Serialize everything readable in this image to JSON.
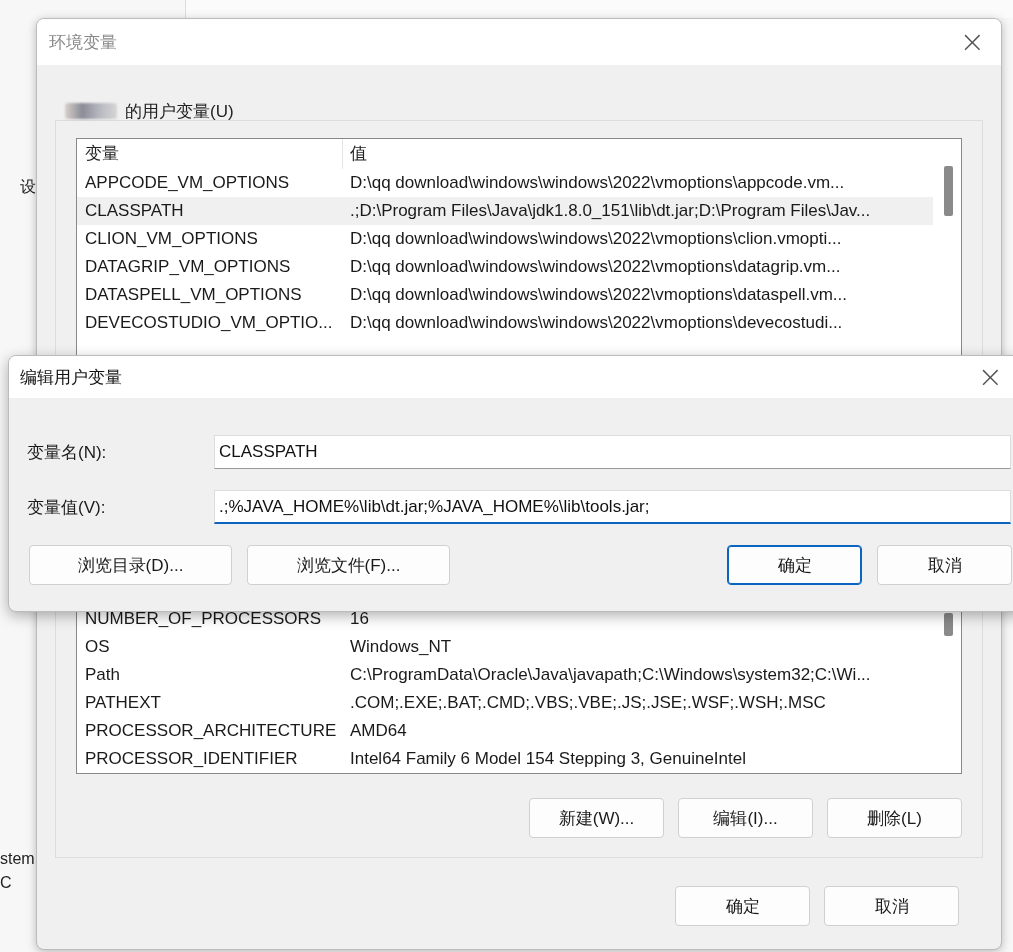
{
  "background_app": {
    "left_top": [
      "设"
    ],
    "left_bottom": [
      "stem",
      "C"
    ]
  },
  "env_dialog": {
    "title": "环境变量",
    "close": "×",
    "group_label": "的用户变量(U)",
    "table": {
      "columns": [
        "变量",
        "值"
      ],
      "rows_top": [
        {
          "name": "APPCODE_VM_OPTIONS",
          "value": "D:\\qq download\\windows\\windows\\2022\\vmoptions\\appcode.vm...",
          "selected": false
        },
        {
          "name": "CLASSPATH",
          "value": ".;D:\\Program Files\\Java\\jdk1.8.0_151\\lib\\dt.jar;D:\\Program Files\\Jav...",
          "selected": true
        },
        {
          "name": "CLION_VM_OPTIONS",
          "value": "D:\\qq download\\windows\\windows\\2022\\vmoptions\\clion.vmopti...",
          "selected": false
        },
        {
          "name": "DATAGRIP_VM_OPTIONS",
          "value": "D:\\qq download\\windows\\windows\\2022\\vmoptions\\datagrip.vm...",
          "selected": false
        },
        {
          "name": "DATASPELL_VM_OPTIONS",
          "value": "D:\\qq download\\windows\\windows\\2022\\vmoptions\\dataspell.vm...",
          "selected": false
        },
        {
          "name": "DEVECOSTUDIO_VM_OPTIO...",
          "value": "D:\\qq download\\windows\\windows\\2022\\vmoptions\\devecostudi...",
          "selected": false
        }
      ],
      "rows_bottom": [
        {
          "name": "NUMBER_OF_PROCESSORS",
          "value": "16",
          "selected": false
        },
        {
          "name": "OS",
          "value": "Windows_NT",
          "selected": false
        },
        {
          "name": "Path",
          "value": "C:\\ProgramData\\Oracle\\Java\\javapath;C:\\Windows\\system32;C:\\Wi...",
          "selected": false
        },
        {
          "name": "PATHEXT",
          "value": ".COM;.EXE;.BAT;.CMD;.VBS;.VBE;.JS;.JSE;.WSF;.WSH;.MSC",
          "selected": false
        },
        {
          "name": "PROCESSOR_ARCHITECTURE",
          "value": "AMD64",
          "selected": false
        },
        {
          "name": "PROCESSOR_IDENTIFIER",
          "value": "Intel64 Family 6 Model 154 Stepping 3, GenuineIntel",
          "selected": false
        }
      ]
    },
    "table_buttons": [
      "新建(W)...",
      "编辑(I)...",
      "删除(L)"
    ],
    "buttons": [
      {
        "label": "确定",
        "default": false
      },
      {
        "label": "取消",
        "default": false
      }
    ]
  },
  "edit_dialog": {
    "title": "编辑用户变量",
    "close": "×",
    "fields": [
      {
        "label": "变量名(N):",
        "value": "CLASSPATH",
        "focused": false
      },
      {
        "label": "变量值(V):",
        "value": ".;%JAVA_HOME%\\lib\\dt.jar;%JAVA_HOME%\\lib\\tools.jar;",
        "focused": true
      }
    ],
    "left_buttons": [
      "浏览目录(D)...",
      "浏览文件(F)..."
    ],
    "buttons": [
      {
        "label": "确定",
        "default": true
      },
      {
        "label": "取消",
        "default": false
      }
    ]
  }
}
